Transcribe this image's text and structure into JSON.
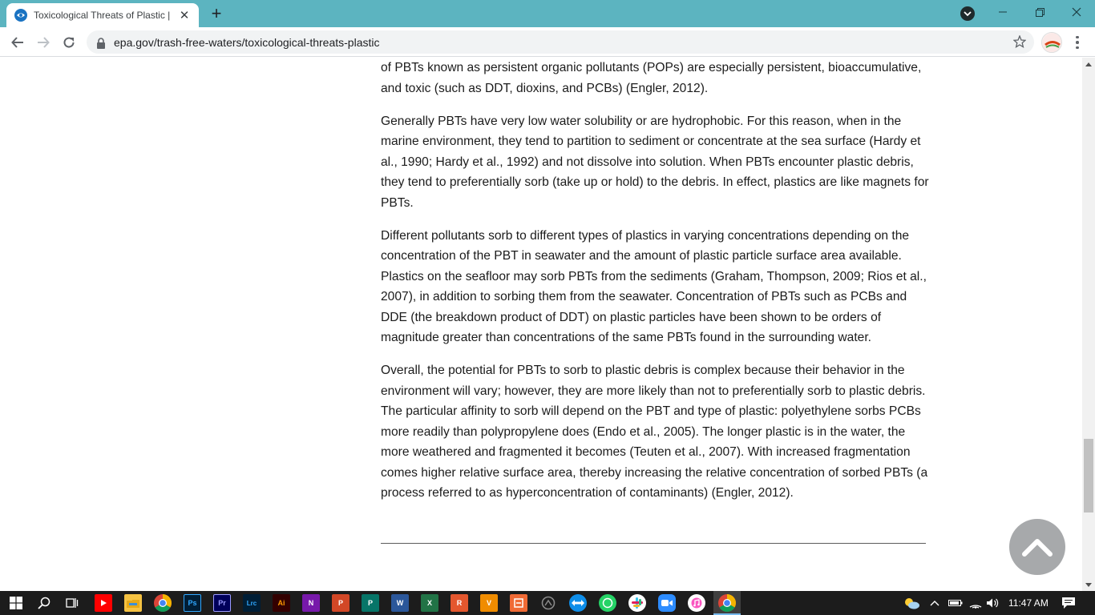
{
  "browser": {
    "tab_title": "Toxicological Threats of Plastic | U",
    "new_tab_label": "+",
    "url": "epa.gov/trash-free-waters/toxicological-threats-plastic"
  },
  "article": {
    "paragraphs": [
      "of PBTs known as persistent organic pollutants (POPs) are especially persistent, bioaccumulative, and toxic (such as DDT, dioxins, and PCBs) (Engler, 2012).",
      "Generally PBTs have very low water solubility or are hydrophobic. For this reason, when in the marine environment, they tend to partition to sediment or concentrate at the sea surface (Hardy et al., 1990; Hardy et al., 1992) and not dissolve into solution. When PBTs encounter plastic debris, they tend to preferentially sorb (take up or hold) to the debris. In effect, plastics are like magnets for PBTs.",
      "Different pollutants sorb to different types of plastics in varying concentrations depending on the concentration of the PBT in seawater and the amount of plastic particle surface area available. Plastics on the seafloor may sorb PBTs from the sediments (Graham, Thompson, 2009; Rios et al., 2007), in addition to sorbing them from the seawater. Concentration of PBTs such as PCBs and DDE (the breakdown product of DDT) on plastic particles have been shown to be orders of magnitude greater than concentrations of the same PBTs found in the surrounding water.",
      "Overall, the potential for PBTs to sorb to plastic debris is complex because their behavior in the environment will vary; however, they are more likely than not to preferentially sorb to plastic debris. The particular affinity to sorb will depend on the PBT and type of plastic: polyethylene sorbs PCBs more readily than polypropylene does (Endo et al., 2005). The longer plastic is in the water, the more weathered and fragmented it becomes (Teuten et al., 2007). With increased fragmentation comes higher relative surface area, thereby increasing the relative concentration of sorbed PBTs (a process referred to as hyperconcentration of contaminants) (Engler, 2012)."
    ]
  },
  "taskbar": {
    "apps": [
      {
        "name": "youtube-icon",
        "label": "",
        "color": "#ff0000"
      },
      {
        "name": "file-explorer-icon",
        "label": "",
        "color": "#f5c242"
      },
      {
        "name": "chrome-icon",
        "label": "",
        "color": "#4285f4"
      },
      {
        "name": "photoshop-icon",
        "label": "Ps",
        "color": "#31a8ff"
      },
      {
        "name": "premiere-icon",
        "label": "Pr",
        "color": "#9999ff"
      },
      {
        "name": "lightroom-classic-icon",
        "label": "Lrc",
        "color": "#31a8ff"
      },
      {
        "name": "illustrator-icon",
        "label": "Ai",
        "color": "#ff9a00"
      },
      {
        "name": "onenote-icon",
        "label": "N",
        "color": "#7719aa"
      },
      {
        "name": "powerpoint-icon",
        "label": "P",
        "color": "#d24726"
      },
      {
        "name": "publisher-icon",
        "label": "P",
        "color": "#077568"
      },
      {
        "name": "word-icon",
        "label": "W",
        "color": "#2b579a"
      },
      {
        "name": "excel-icon",
        "label": "X",
        "color": "#217346"
      },
      {
        "name": "app-r-icon",
        "label": "R",
        "color": "#e4572e"
      },
      {
        "name": "app-v-icon",
        "label": "V",
        "color": "#f08c00"
      },
      {
        "name": "app-orange-icon",
        "label": "",
        "color": "#f06a35"
      },
      {
        "name": "app-gray-icon",
        "label": "",
        "color": "#8a8a8a"
      },
      {
        "name": "teamviewer-icon",
        "label": "",
        "color": "#0e8ee9"
      },
      {
        "name": "whatsapp-icon",
        "label": "",
        "color": "#25d366"
      },
      {
        "name": "slack-icon",
        "label": "",
        "color": "#e9a820"
      },
      {
        "name": "zoom-icon",
        "label": "",
        "color": "#2d8cff"
      },
      {
        "name": "itunes-icon",
        "label": "",
        "color": "#fa57c1"
      },
      {
        "name": "chrome-active-icon",
        "label": "",
        "color": "#4285f4"
      }
    ],
    "clock": "11:47 AM"
  },
  "colors": {
    "tabstrip": "#5cb4c0",
    "scroll_top_button": "#a7a9ab",
    "taskbar": "#1c1c1c"
  }
}
